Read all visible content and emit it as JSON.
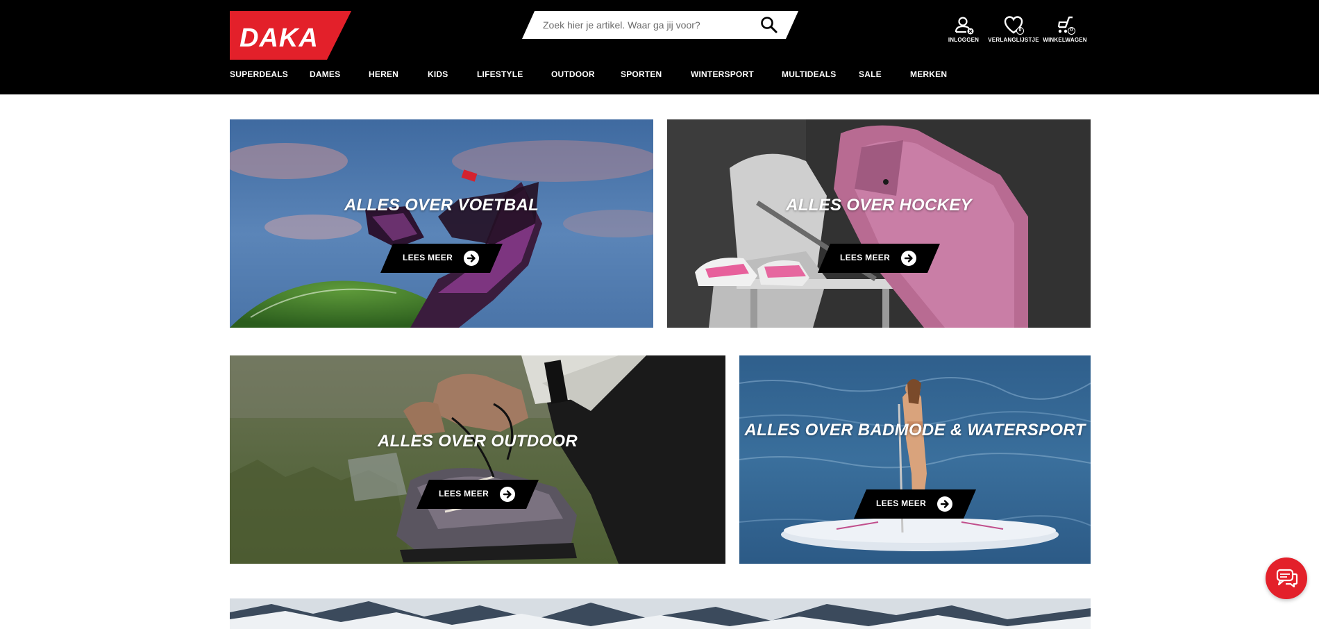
{
  "brand": {
    "logo_text": "DAKA",
    "accent_color": "#e3202a"
  },
  "search": {
    "placeholder": "Zoek hier je artikel. Waar ga jij voor?"
  },
  "header_actions": [
    {
      "label": "INLOGGEN",
      "icon": "user-icon"
    },
    {
      "label": "VERLANGLIJSTJE",
      "icon": "heart-icon",
      "count": "0"
    },
    {
      "label": "WINKELWAGEN",
      "icon": "cart-icon",
      "count": "0"
    }
  ],
  "nav": [
    {
      "label": "SUPERDEALS"
    },
    {
      "label": "DAMES"
    },
    {
      "label": "HEREN"
    },
    {
      "label": "KIDS"
    },
    {
      "label": "LIFESTYLE"
    },
    {
      "label": "OUTDOOR"
    },
    {
      "label": "SPORTEN"
    },
    {
      "label": "WINTERSPORT"
    },
    {
      "label": "MULTIDEALS"
    },
    {
      "label": "SALE"
    },
    {
      "label": "MERKEN"
    }
  ],
  "tiles": [
    {
      "title": "ALLES OVER VOETBAL",
      "cta": "LEES MEER"
    },
    {
      "title": "ALLES OVER HOCKEY",
      "cta": "LEES MEER"
    },
    {
      "title": "ALLES OVER OUTDOOR",
      "cta": "LEES MEER"
    },
    {
      "title": "ALLES OVER BADMODE & WATERSPORT",
      "cta": "LEES MEER"
    }
  ],
  "chat": {
    "icon": "chat-icon"
  }
}
